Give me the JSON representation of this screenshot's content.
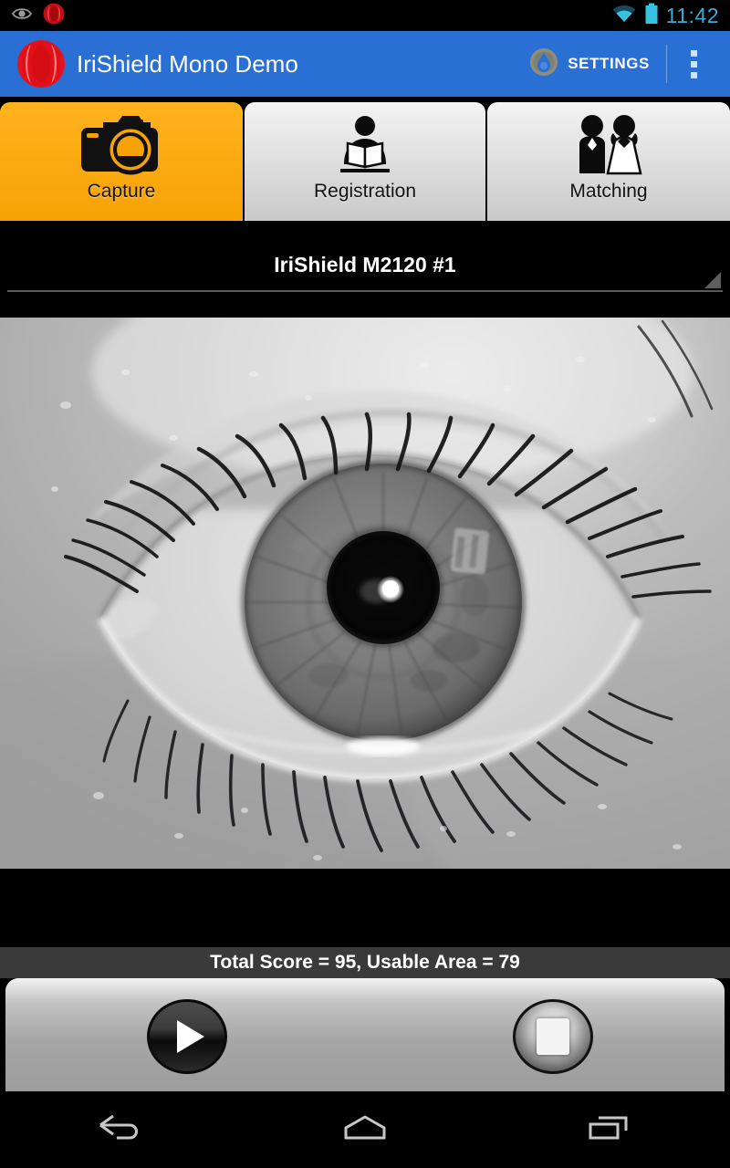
{
  "statusbar": {
    "time": "11:42",
    "icons": [
      "eye-preview-icon",
      "irishield-notification-icon",
      "wifi-icon",
      "battery-icon"
    ],
    "time_color": "#3fa9d4"
  },
  "actionbar": {
    "title": "IriShield Mono Demo",
    "logo_icon": "irishield-logo-icon",
    "settings_label": "SETTINGS",
    "settings_icon": "settings-droplet-icon",
    "overflow_icon": "overflow-menu-icon",
    "background_color": "#2a6fd4"
  },
  "tabs": [
    {
      "label": "Capture",
      "icon": "camera-icon",
      "active": true,
      "accent": "#f7a308"
    },
    {
      "label": "Registration",
      "icon": "person-reading-icon",
      "active": false,
      "accent": "#d8d8d8"
    },
    {
      "label": "Matching",
      "icon": "couple-icon",
      "active": false,
      "accent": "#d8d8d8"
    }
  ],
  "device_spinner": {
    "selected": "IriShield M2120 #1",
    "caret_icon": "spinner-caret-icon"
  },
  "preview": {
    "image_description": "grayscale-iris-capture",
    "alt": "Live grayscale iris camera preview"
  },
  "status": {
    "score_text": "Total Score = 95, Usable Area = 79",
    "total_score": 95,
    "usable_area": 79
  },
  "controls": {
    "play_label": "Start capture",
    "play_icon": "play-icon",
    "stop_label": "Stop capture",
    "stop_icon": "stop-icon"
  },
  "navbar": {
    "back_icon": "back-icon",
    "home_icon": "home-icon",
    "recents_icon": "recents-icon"
  }
}
